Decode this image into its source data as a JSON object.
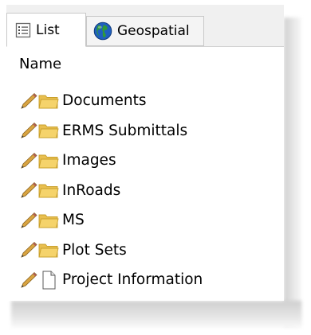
{
  "tabs": [
    {
      "label": "List",
      "icon": "list-icon",
      "active": true
    },
    {
      "label": "Geospatial",
      "icon": "globe-icon",
      "active": false
    }
  ],
  "column_header": "Name",
  "items": [
    {
      "label": "Documents",
      "type": "folder",
      "icons": [
        "pencil-icon",
        "folder-icon"
      ]
    },
    {
      "label": "ERMS Submittals",
      "type": "folder",
      "icons": [
        "pencil-icon",
        "folder-icon"
      ]
    },
    {
      "label": "Images",
      "type": "folder",
      "icons": [
        "pencil-icon",
        "folder-icon"
      ]
    },
    {
      "label": "InRoads",
      "type": "folder",
      "icons": [
        "pencil-icon",
        "folder-icon"
      ]
    },
    {
      "label": "MS",
      "type": "folder",
      "icons": [
        "pencil-icon",
        "folder-icon"
      ]
    },
    {
      "label": "Plot Sets",
      "type": "folder",
      "icons": [
        "pencil-icon",
        "folder-icon"
      ]
    },
    {
      "label": "Project Information",
      "type": "document",
      "icons": [
        "pencil-icon",
        "document-icon"
      ]
    }
  ],
  "colors": {
    "folder_fill": "#f5d36b",
    "folder_edge": "#c9a02c",
    "pencil_body": "#d9a441",
    "pencil_tip": "#3a3a3a",
    "globe_ocean": "#1f5fbf",
    "globe_land": "#2f9a3a",
    "tab_border": "#c8c8c8"
  }
}
